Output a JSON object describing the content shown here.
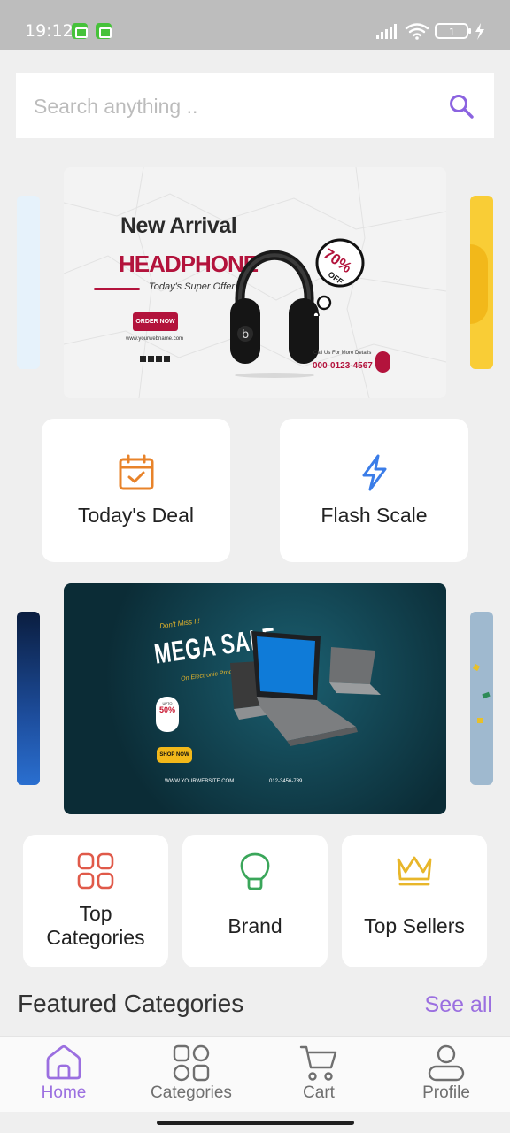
{
  "status_bar": {
    "time": "19:12",
    "battery": "1"
  },
  "search": {
    "placeholder": "Search anything .."
  },
  "banner1": {
    "headline": "New Arrival",
    "product": "HEADPHONE",
    "tagline": "Today's Super Offer",
    "cta": "ORDER NOW",
    "website": "www.yourwebname.com",
    "discount_value": "70%",
    "discount_word": "OFF",
    "contact_label": "Call Us For More Details",
    "phone": "000-0123-4567"
  },
  "banner2": {
    "pretitle": "Don't Miss It!",
    "title": "MEGA SALE",
    "subtitle": "On Electronic Products",
    "badge_top": "UPTO",
    "badge_value": "50%",
    "cta": "SHOP NOW",
    "website": "WWW.YOURWEBSITE.COM",
    "phone": "012-3456-789"
  },
  "quick_links": [
    {
      "label": "Today's Deal",
      "icon": "calendar-check-icon",
      "color": "#e8832a"
    },
    {
      "label": "Flash Scale",
      "icon": "lightning-icon",
      "color": "#3b7de8"
    }
  ],
  "shortcuts": [
    {
      "label": "Top Categories",
      "icon": "categories-grid-icon",
      "color": "#e05a4a"
    },
    {
      "label": "Brand",
      "icon": "lightbulb-icon",
      "color": "#3aa65a"
    },
    {
      "label": "Top Sellers",
      "icon": "crown-icon",
      "color": "#e8b62a"
    }
  ],
  "featured": {
    "title": "Featured Categories",
    "see_all": "See all"
  },
  "bottom_nav": [
    {
      "label": "Home",
      "icon": "home-icon",
      "active": true
    },
    {
      "label": "Categories",
      "icon": "categories-icon",
      "active": false
    },
    {
      "label": "Cart",
      "icon": "cart-icon",
      "active": false
    },
    {
      "label": "Profile",
      "icon": "profile-icon",
      "active": false
    }
  ],
  "colors": {
    "accent": "#9b6fe0",
    "background": "#efefef",
    "card": "#ffffff"
  }
}
